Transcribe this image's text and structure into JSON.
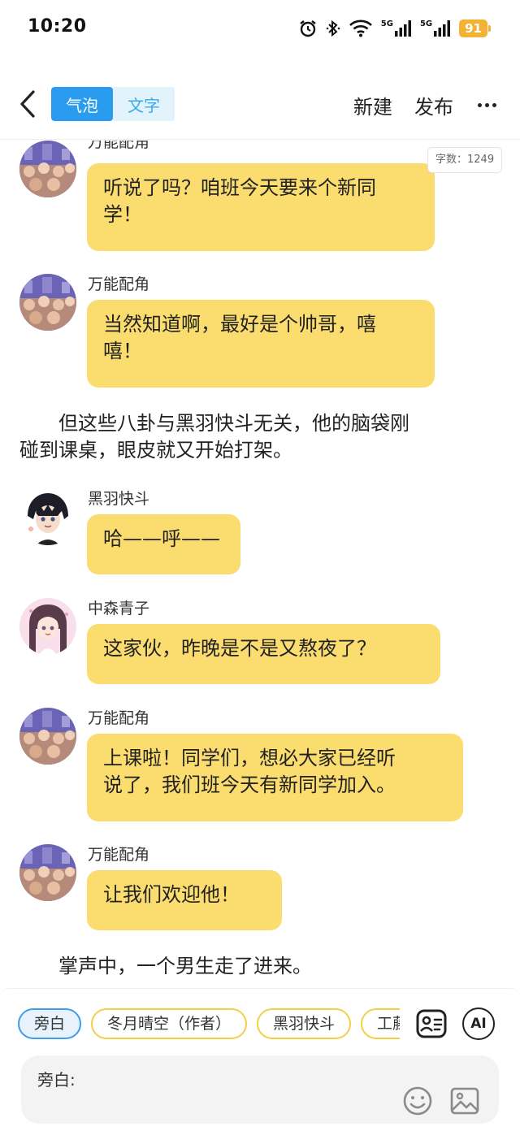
{
  "status_bar": {
    "time": "10:20",
    "signal_label_1": "5G",
    "signal_label_2": "5G",
    "battery": "91",
    "icons": [
      "alarm-icon",
      "bluetooth-icon",
      "wifi-icon",
      "signal-icon",
      "signal-icon",
      "battery-icon"
    ]
  },
  "header": {
    "tabs": [
      {
        "label": "气泡",
        "active": true
      },
      {
        "label": "文字",
        "active": false
      }
    ],
    "new_label": "新建",
    "publish_label": "发布"
  },
  "word_count": "字数：1249",
  "messages": [
    {
      "type": "bubble",
      "speaker": "万能配角",
      "text_lines": [
        "听说了吗？咱班今天要来个新同",
        "学！"
      ]
    },
    {
      "type": "bubble",
      "speaker": "万能配角",
      "text_lines": [
        "当然知道啊，最好是个帅哥，嘻",
        "嘻！"
      ]
    },
    {
      "type": "narration",
      "text_lines": [
        "　　但这些八卦与黑羽快斗无关，他的脑袋刚",
        "碰到课桌，眼皮就又开始打架。"
      ]
    },
    {
      "type": "bubble",
      "speaker": "黑羽快斗",
      "text_lines": [
        "哈——呼——"
      ]
    },
    {
      "type": "bubble",
      "speaker": "中森青子",
      "text_lines": [
        "这家伙，昨晚是不是又熬夜了？"
      ]
    },
    {
      "type": "bubble",
      "speaker": "万能配角",
      "text_lines": [
        "上课啦！同学们，想必大家已经听",
        "说了，我们班今天有新同学加入。"
      ]
    },
    {
      "type": "bubble",
      "speaker": "万能配角",
      "text_lines": [
        "让我们欢迎他！"
      ]
    },
    {
      "type": "narration",
      "text_lines": [
        "　　掌声中，一个男生走了进来。"
      ]
    }
  ],
  "roles": [
    {
      "label": "旁白",
      "active": true
    },
    {
      "label": "冬月晴空（作者）",
      "active": false
    },
    {
      "label": "黑羽快斗",
      "active": false
    },
    {
      "label": "工藤",
      "active": false
    }
  ],
  "tools": {
    "ai_label": "AI"
  },
  "composer": {
    "label": "旁白:",
    "value": ""
  },
  "colors": {
    "accent": "#2a9cf0",
    "bubble": "#fbdc6e",
    "chip_border": "#f1cf4a",
    "battery": "#f2b233"
  }
}
